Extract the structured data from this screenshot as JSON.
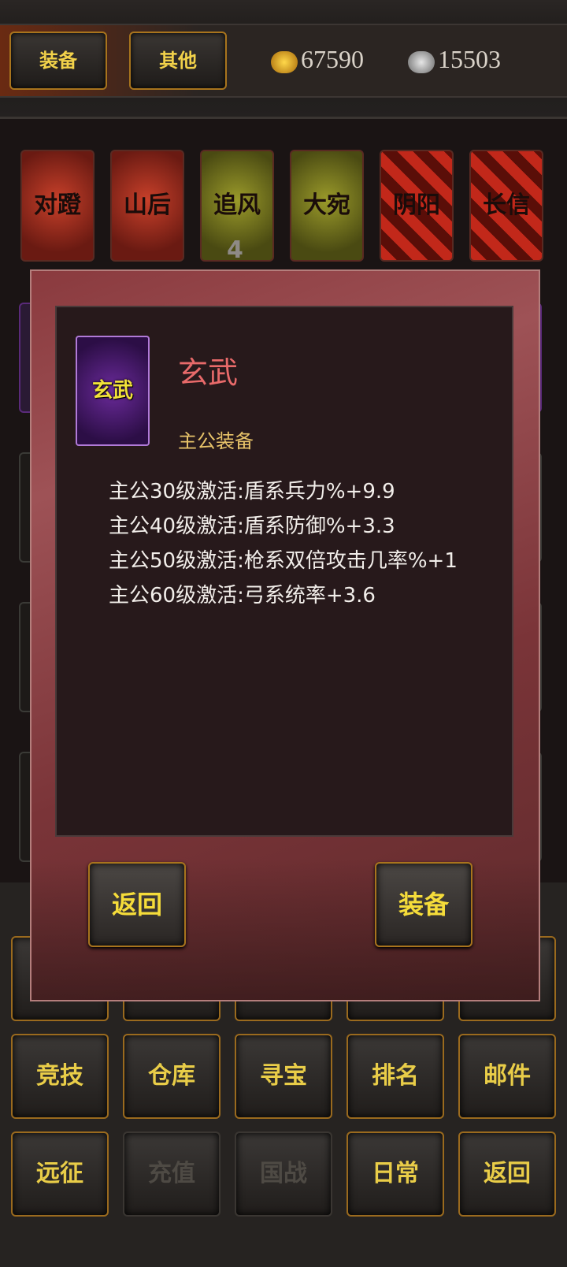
{
  "top_tabs": [
    {
      "label": "装备"
    },
    {
      "label": "其他"
    }
  ],
  "currency": {
    "gold": "67590",
    "silver": "15503"
  },
  "mounts": [
    {
      "label": "对蹬",
      "color": "red"
    },
    {
      "label": "山后",
      "color": "red"
    },
    {
      "label": "追风",
      "color": "yellow"
    },
    {
      "label": "大宛",
      "color": "yellow"
    },
    {
      "label": "阴阳",
      "color": "diamond"
    },
    {
      "label": "长信",
      "color": "diamond"
    }
  ],
  "badge_count": "4",
  "modal": {
    "item_icon_label": "玄武",
    "item_name": "玄武",
    "item_type": "主公装备",
    "stats": [
      "主公30级激活:盾系兵力%+9.9",
      "主公40级激活:盾系防御%+3.3",
      "主公50级激活:枪系双倍攻击几率%+1",
      "主公60级激活:弓系统率+3.6"
    ],
    "back_label": "返回",
    "equip_label": "装备"
  },
  "bottom_grid": {
    "row2": [
      "竞技",
      "仓库",
      "寻宝",
      "排名",
      "邮件"
    ],
    "row3": [
      "远征",
      "充值",
      "国战",
      "日常",
      "返回"
    ]
  },
  "colors": {
    "accent_gold": "#f5dc3a",
    "title_red": "#e86a6a",
    "type_gold": "#e8c46a"
  }
}
